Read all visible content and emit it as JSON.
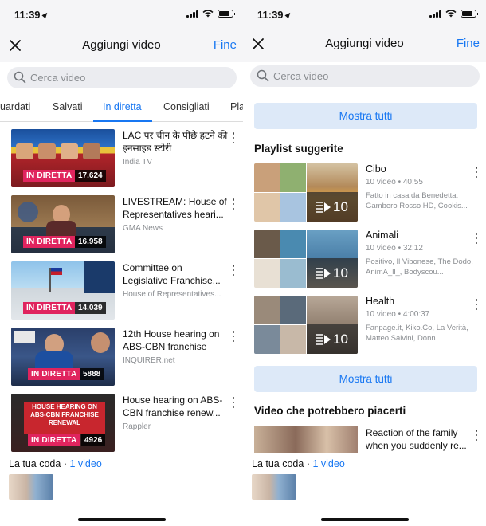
{
  "status": {
    "time": "11:39"
  },
  "header": {
    "title": "Aggiungi video",
    "done_label": "Fine"
  },
  "search": {
    "placeholder": "Cerca video"
  },
  "tabs": [
    {
      "label": "uardati"
    },
    {
      "label": "Salvati"
    },
    {
      "label": "In diretta",
      "active": true
    },
    {
      "label": "Consigliati"
    },
    {
      "label": "Pla"
    }
  ],
  "live_videos": [
    {
      "title": "LAC पर चीन के पीछे हटने की इनसाइड स्टोरी",
      "source": "India TV",
      "badge": "IN DIRETTA",
      "viewers": "17.624"
    },
    {
      "title": "LIVESTREAM: House of Representatives heari...",
      "source": "GMA News",
      "badge": "IN DIRETTA",
      "viewers": "16.958"
    },
    {
      "title": "Committee on Legislative Franchise...",
      "source": "House of Representatives...",
      "badge": "IN DIRETTA",
      "viewers": "14.039"
    },
    {
      "title": "12th House hearing on ABS-CBN franchise",
      "source": "INQUIRER.net",
      "badge": "IN DIRETTA",
      "viewers": "5888"
    },
    {
      "title": "House hearing on ABS-CBN franchise renew...",
      "source": "Rappler",
      "badge": "IN DIRETTA",
      "viewers": "4926",
      "thumb_text": "HOUSE HEARING ON ABS-CBN FRANCHISE RENEWAL"
    }
  ],
  "queue": {
    "label": "La tua coda",
    "separator": "·",
    "count": "1 video"
  },
  "right_panel": {
    "show_all_label": "Mostra tutti",
    "playlists_title": "Playlist suggerite",
    "playlists": [
      {
        "name": "Cibo",
        "meta": "10 video • 40:55",
        "desc": "Fatto in casa da Benedetta, Gambero Rosso HD, Cookis...",
        "count": "10"
      },
      {
        "name": "Animali",
        "meta": "10 video • 32:12",
        "desc": "Positivo, Il Vibonese, The Dodo, AnimA_ll_, Bodyscou...",
        "count": "10"
      },
      {
        "name": "Health",
        "meta": "10 video • 4:00:37",
        "desc": "Fanpage.it, Kiko.Co, La Verità, Matteo Salvini, Donn...",
        "count": "10"
      }
    ],
    "recommended_title": "Video che potrebbero piacerti",
    "recommended": [
      {
        "title": "Reaction of the family when you suddenly re..."
      }
    ]
  },
  "colors": {
    "accent": "#1877f2",
    "live": "#e0245e",
    "show_all_bg": "#dde9f8",
    "header_bg": "#f5f5f7"
  },
  "icons": [
    "location-arrow-icon",
    "signal-icon",
    "wifi-icon",
    "battery-icon",
    "close-icon",
    "search-icon",
    "more-vertical-icon",
    "playlist-play-icon"
  ]
}
